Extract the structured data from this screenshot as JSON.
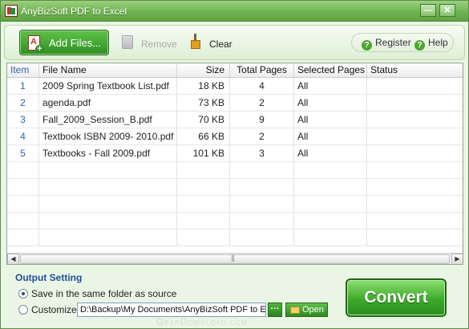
{
  "window": {
    "title": "AnyBizSoft PDF to Excel",
    "min_label": "—",
    "close_label": "✕"
  },
  "toolbar": {
    "add_files": "Add Files...",
    "remove": "Remove",
    "clear": "Clear",
    "register": "Register",
    "help": "Help"
  },
  "table": {
    "headers": [
      "Item",
      "File Name",
      "Size",
      "Total Pages",
      "Selected Pages",
      "Status"
    ],
    "rows": [
      {
        "item": "1",
        "name": "2009 Spring Textbook List.pdf",
        "size": "18  KB",
        "pages": "4",
        "selected": "All",
        "status": ""
      },
      {
        "item": "2",
        "name": "agenda.pdf",
        "size": "73  KB",
        "pages": "2",
        "selected": "All",
        "status": ""
      },
      {
        "item": "3",
        "name": "Fall_2009_Session_B.pdf",
        "size": "70  KB",
        "pages": "9",
        "selected": "All",
        "status": ""
      },
      {
        "item": "4",
        "name": "Textbook ISBN 2009- 2010.pdf",
        "size": "66  KB",
        "pages": "2",
        "selected": "All",
        "status": ""
      },
      {
        "item": "5",
        "name": "Textbooks - Fall 2009.pdf",
        "size": "101  KB",
        "pages": "3",
        "selected": "All",
        "status": ""
      }
    ]
  },
  "output": {
    "title": "Output Setting",
    "same_folder_label": "Save in the same folder as source",
    "customize_label": "Customize",
    "path_value": "D:\\Backup\\My Documents\\AnyBizSoft PDF to Excel",
    "browse_label": "···",
    "open_label": "Open",
    "convert_label": "Convert"
  },
  "watermark": "GearDownload.com",
  "icons": {
    "app": "app-icon",
    "add": "add-pdf-icon",
    "remove": "trash-icon",
    "clear": "broom-icon",
    "help": "question-icon",
    "folder": "folder-icon"
  }
}
